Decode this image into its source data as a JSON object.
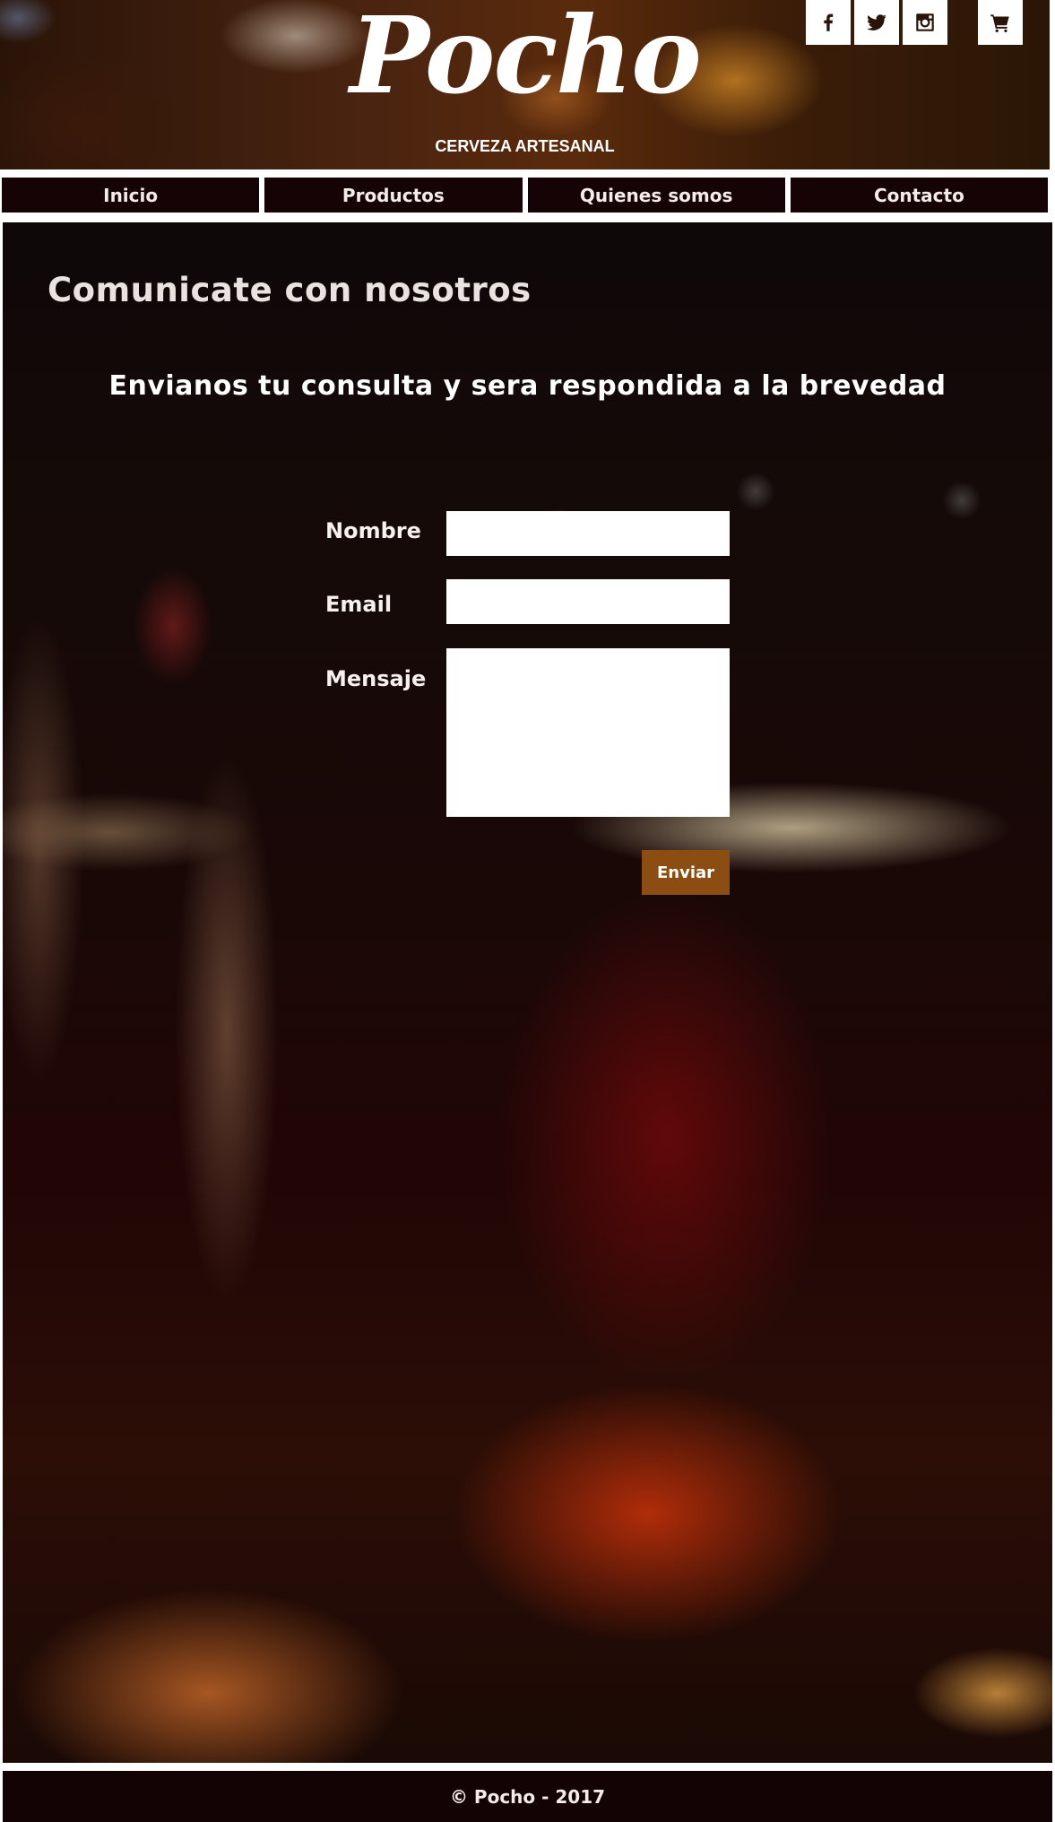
{
  "header": {
    "logo_text": "Pocho",
    "tagline": "CERVEZA ARTESANAL",
    "social_icons": [
      "facebook-icon",
      "twitter-icon",
      "instagram-icon"
    ],
    "cart_icon": "cart-icon"
  },
  "nav": {
    "items": [
      {
        "label": "Inicio"
      },
      {
        "label": "Productos"
      },
      {
        "label": "Quienes somos"
      },
      {
        "label": "Contacto"
      }
    ]
  },
  "contact": {
    "title": "Comunicate con nosotros",
    "subtitle": "Envianos tu consulta y sera respondida a la brevedad",
    "fields": {
      "nombre": {
        "label": "Nombre",
        "value": ""
      },
      "email": {
        "label": "Email",
        "value": ""
      },
      "mensaje": {
        "label": "Mensaje",
        "value": ""
      }
    },
    "submit_label": "Enviar"
  },
  "footer": {
    "text": "© Pocho - 2017"
  },
  "colors": {
    "nav_bg": "#150306",
    "footer_bg": "#140305",
    "button_bg": "#8b4d12",
    "icon_fill": "#2a1409"
  }
}
